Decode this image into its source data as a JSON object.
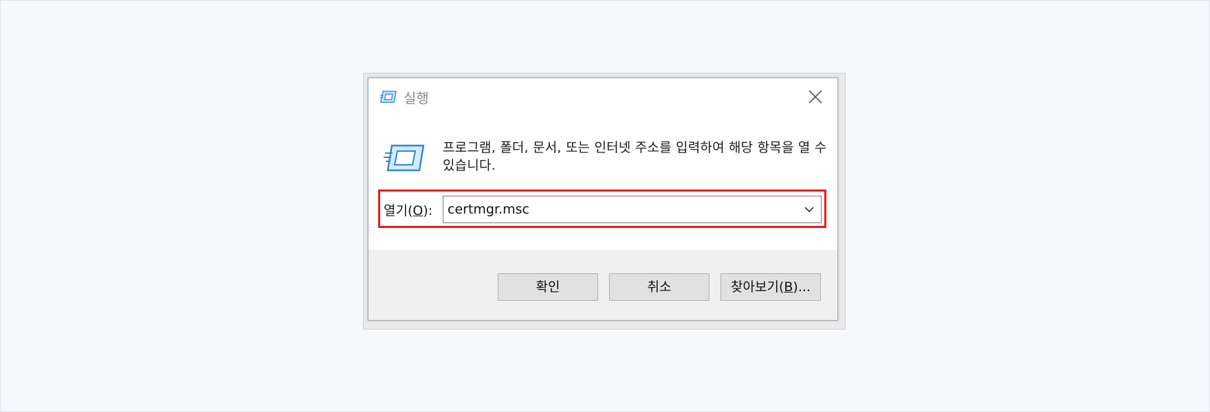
{
  "window": {
    "title": "실행",
    "title_icon": "run-icon",
    "close_icon": "close-icon"
  },
  "dialog": {
    "icon": "run-icon",
    "description": "프로그램, 폴더, 문서, 또는 인터넷 주소를 입력하여 해당 항목을 열 수 있습니다.",
    "open_label_prefix": "열기(",
    "open_label_access_key": "O",
    "open_label_suffix": "):",
    "open_value": "certmgr.msc",
    "dropdown_icon": "chevron-down-icon",
    "highlight_color": "#e41c1c"
  },
  "buttons": {
    "ok": "확인",
    "cancel": "취소",
    "browse_prefix": "찾아보기(",
    "browse_access_key": "B",
    "browse_suffix": ")..."
  },
  "colors": {
    "page_background": "#f6f9fc",
    "dialog_footer": "#f0f0f0",
    "button_face": "#e1e1e1",
    "icon_blue": "#3b8fd9"
  }
}
